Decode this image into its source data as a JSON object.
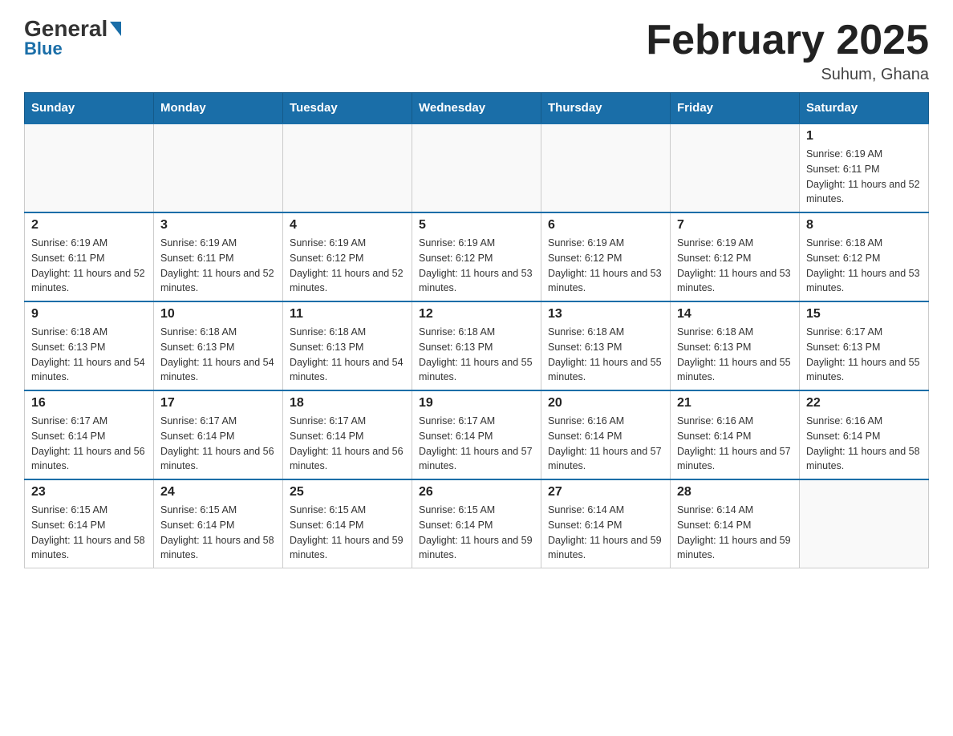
{
  "header": {
    "logo_general": "General",
    "logo_blue": "Blue",
    "title": "February 2025",
    "location": "Suhum, Ghana"
  },
  "days_of_week": [
    "Sunday",
    "Monday",
    "Tuesday",
    "Wednesday",
    "Thursday",
    "Friday",
    "Saturday"
  ],
  "weeks": [
    [
      null,
      null,
      null,
      null,
      null,
      null,
      {
        "day": "1",
        "sunrise": "Sunrise: 6:19 AM",
        "sunset": "Sunset: 6:11 PM",
        "daylight": "Daylight: 11 hours and 52 minutes."
      }
    ],
    [
      {
        "day": "2",
        "sunrise": "Sunrise: 6:19 AM",
        "sunset": "Sunset: 6:11 PM",
        "daylight": "Daylight: 11 hours and 52 minutes."
      },
      {
        "day": "3",
        "sunrise": "Sunrise: 6:19 AM",
        "sunset": "Sunset: 6:11 PM",
        "daylight": "Daylight: 11 hours and 52 minutes."
      },
      {
        "day": "4",
        "sunrise": "Sunrise: 6:19 AM",
        "sunset": "Sunset: 6:12 PM",
        "daylight": "Daylight: 11 hours and 52 minutes."
      },
      {
        "day": "5",
        "sunrise": "Sunrise: 6:19 AM",
        "sunset": "Sunset: 6:12 PM",
        "daylight": "Daylight: 11 hours and 53 minutes."
      },
      {
        "day": "6",
        "sunrise": "Sunrise: 6:19 AM",
        "sunset": "Sunset: 6:12 PM",
        "daylight": "Daylight: 11 hours and 53 minutes."
      },
      {
        "day": "7",
        "sunrise": "Sunrise: 6:19 AM",
        "sunset": "Sunset: 6:12 PM",
        "daylight": "Daylight: 11 hours and 53 minutes."
      },
      {
        "day": "8",
        "sunrise": "Sunrise: 6:18 AM",
        "sunset": "Sunset: 6:12 PM",
        "daylight": "Daylight: 11 hours and 53 minutes."
      }
    ],
    [
      {
        "day": "9",
        "sunrise": "Sunrise: 6:18 AM",
        "sunset": "Sunset: 6:13 PM",
        "daylight": "Daylight: 11 hours and 54 minutes."
      },
      {
        "day": "10",
        "sunrise": "Sunrise: 6:18 AM",
        "sunset": "Sunset: 6:13 PM",
        "daylight": "Daylight: 11 hours and 54 minutes."
      },
      {
        "day": "11",
        "sunrise": "Sunrise: 6:18 AM",
        "sunset": "Sunset: 6:13 PM",
        "daylight": "Daylight: 11 hours and 54 minutes."
      },
      {
        "day": "12",
        "sunrise": "Sunrise: 6:18 AM",
        "sunset": "Sunset: 6:13 PM",
        "daylight": "Daylight: 11 hours and 55 minutes."
      },
      {
        "day": "13",
        "sunrise": "Sunrise: 6:18 AM",
        "sunset": "Sunset: 6:13 PM",
        "daylight": "Daylight: 11 hours and 55 minutes."
      },
      {
        "day": "14",
        "sunrise": "Sunrise: 6:18 AM",
        "sunset": "Sunset: 6:13 PM",
        "daylight": "Daylight: 11 hours and 55 minutes."
      },
      {
        "day": "15",
        "sunrise": "Sunrise: 6:17 AM",
        "sunset": "Sunset: 6:13 PM",
        "daylight": "Daylight: 11 hours and 55 minutes."
      }
    ],
    [
      {
        "day": "16",
        "sunrise": "Sunrise: 6:17 AM",
        "sunset": "Sunset: 6:14 PM",
        "daylight": "Daylight: 11 hours and 56 minutes."
      },
      {
        "day": "17",
        "sunrise": "Sunrise: 6:17 AM",
        "sunset": "Sunset: 6:14 PM",
        "daylight": "Daylight: 11 hours and 56 minutes."
      },
      {
        "day": "18",
        "sunrise": "Sunrise: 6:17 AM",
        "sunset": "Sunset: 6:14 PM",
        "daylight": "Daylight: 11 hours and 56 minutes."
      },
      {
        "day": "19",
        "sunrise": "Sunrise: 6:17 AM",
        "sunset": "Sunset: 6:14 PM",
        "daylight": "Daylight: 11 hours and 57 minutes."
      },
      {
        "day": "20",
        "sunrise": "Sunrise: 6:16 AM",
        "sunset": "Sunset: 6:14 PM",
        "daylight": "Daylight: 11 hours and 57 minutes."
      },
      {
        "day": "21",
        "sunrise": "Sunrise: 6:16 AM",
        "sunset": "Sunset: 6:14 PM",
        "daylight": "Daylight: 11 hours and 57 minutes."
      },
      {
        "day": "22",
        "sunrise": "Sunrise: 6:16 AM",
        "sunset": "Sunset: 6:14 PM",
        "daylight": "Daylight: 11 hours and 58 minutes."
      }
    ],
    [
      {
        "day": "23",
        "sunrise": "Sunrise: 6:15 AM",
        "sunset": "Sunset: 6:14 PM",
        "daylight": "Daylight: 11 hours and 58 minutes."
      },
      {
        "day": "24",
        "sunrise": "Sunrise: 6:15 AM",
        "sunset": "Sunset: 6:14 PM",
        "daylight": "Daylight: 11 hours and 58 minutes."
      },
      {
        "day": "25",
        "sunrise": "Sunrise: 6:15 AM",
        "sunset": "Sunset: 6:14 PM",
        "daylight": "Daylight: 11 hours and 59 minutes."
      },
      {
        "day": "26",
        "sunrise": "Sunrise: 6:15 AM",
        "sunset": "Sunset: 6:14 PM",
        "daylight": "Daylight: 11 hours and 59 minutes."
      },
      {
        "day": "27",
        "sunrise": "Sunrise: 6:14 AM",
        "sunset": "Sunset: 6:14 PM",
        "daylight": "Daylight: 11 hours and 59 minutes."
      },
      {
        "day": "28",
        "sunrise": "Sunrise: 6:14 AM",
        "sunset": "Sunset: 6:14 PM",
        "daylight": "Daylight: 11 hours and 59 minutes."
      },
      null
    ]
  ]
}
